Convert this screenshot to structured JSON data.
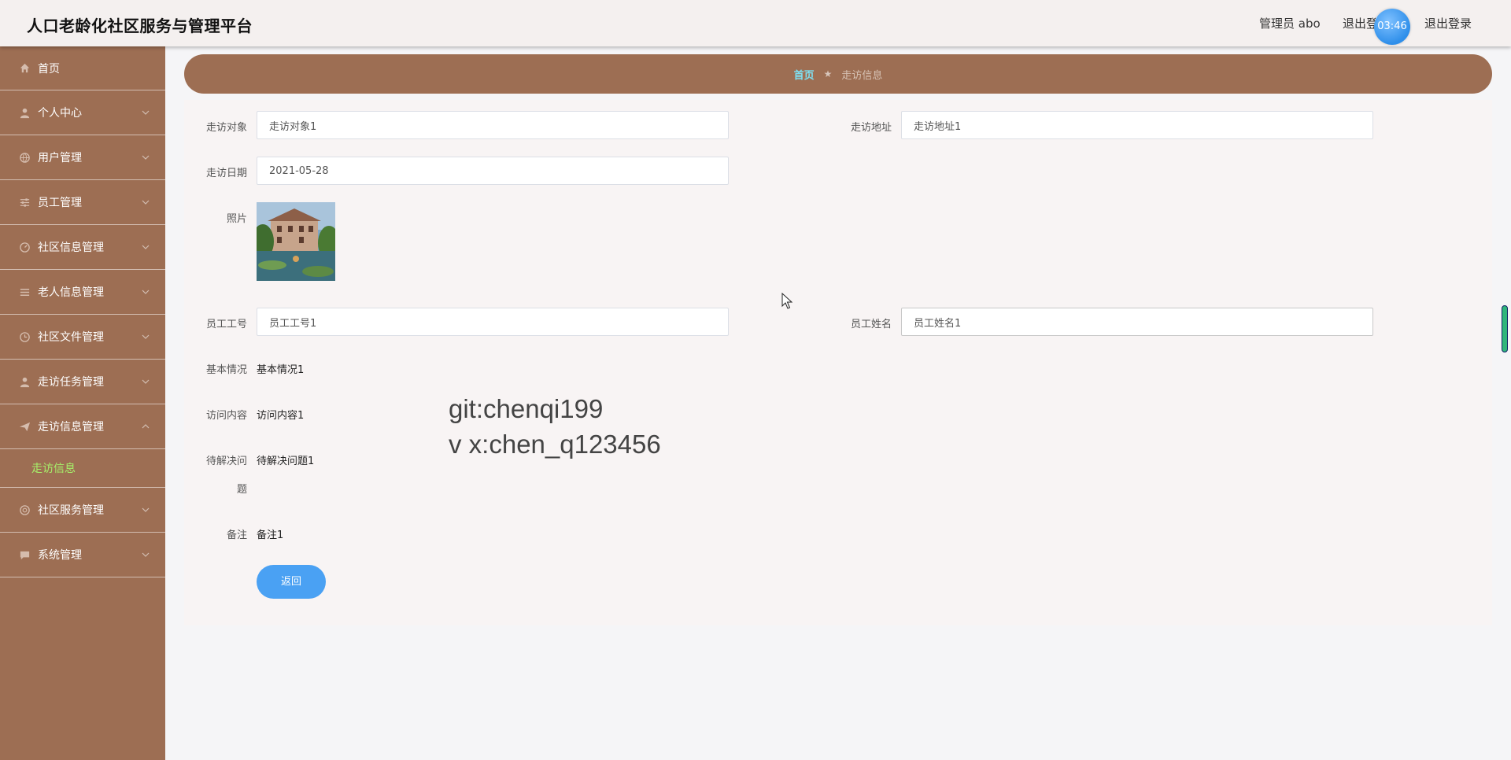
{
  "header": {
    "title": "人口老龄化社区服务与管理平台",
    "admin_label": "管理员 abo",
    "logout_partial": "退出登录",
    "clock": "03:46",
    "logout": "退出登录"
  },
  "sidebar": {
    "items": [
      {
        "label": "首页",
        "icon": "home-icon"
      },
      {
        "label": "个人中心",
        "icon": "user-icon"
      },
      {
        "label": "用户管理",
        "icon": "globe-icon"
      },
      {
        "label": "员工管理",
        "icon": "sliders-icon"
      },
      {
        "label": "社区信息管理",
        "icon": "gauge-icon"
      },
      {
        "label": "老人信息管理",
        "icon": "list-icon"
      },
      {
        "label": "社区文件管理",
        "icon": "clock-icon"
      },
      {
        "label": "走访任务管理",
        "icon": "user-icon"
      },
      {
        "label": "走访信息管理",
        "icon": "send-icon"
      },
      {
        "label": "社区服务管理",
        "icon": "aperture-icon"
      },
      {
        "label": "系统管理",
        "icon": "chat-icon"
      }
    ],
    "active_submenu": "走访信息"
  },
  "breadcrumb": {
    "home": "首页",
    "separator": "★",
    "current": "走访信息"
  },
  "form": {
    "visit_target": {
      "label": "走访对象",
      "value": "走访对象1"
    },
    "visit_address": {
      "label": "走访地址",
      "value": "走访地址1"
    },
    "visit_date": {
      "label": "走访日期",
      "value": "2021-05-28"
    },
    "photo": {
      "label": "照片"
    },
    "employee_id": {
      "label": "员工工号",
      "value": "员工工号1"
    },
    "employee_name": {
      "label": "员工姓名",
      "value": "员工姓名1"
    },
    "basic_info": {
      "label": "基本情况",
      "value": "基本情况1"
    },
    "visit_content": {
      "label": "访问内容",
      "value": "访问内容1"
    },
    "pending_issue": {
      "label_line1": "待解决问",
      "label_line2": "题",
      "value": "待解决问题1"
    },
    "remark": {
      "label": "备注",
      "value": "备注1"
    },
    "back_label": "返回"
  },
  "watermark": {
    "line1": "git:chenqi199",
    "line2": "v x:chen_q123456"
  },
  "colors": {
    "sidebar": "#9d6e53",
    "accent_blue": "#4aa1f3",
    "submenu_active": "#a6f06a"
  }
}
